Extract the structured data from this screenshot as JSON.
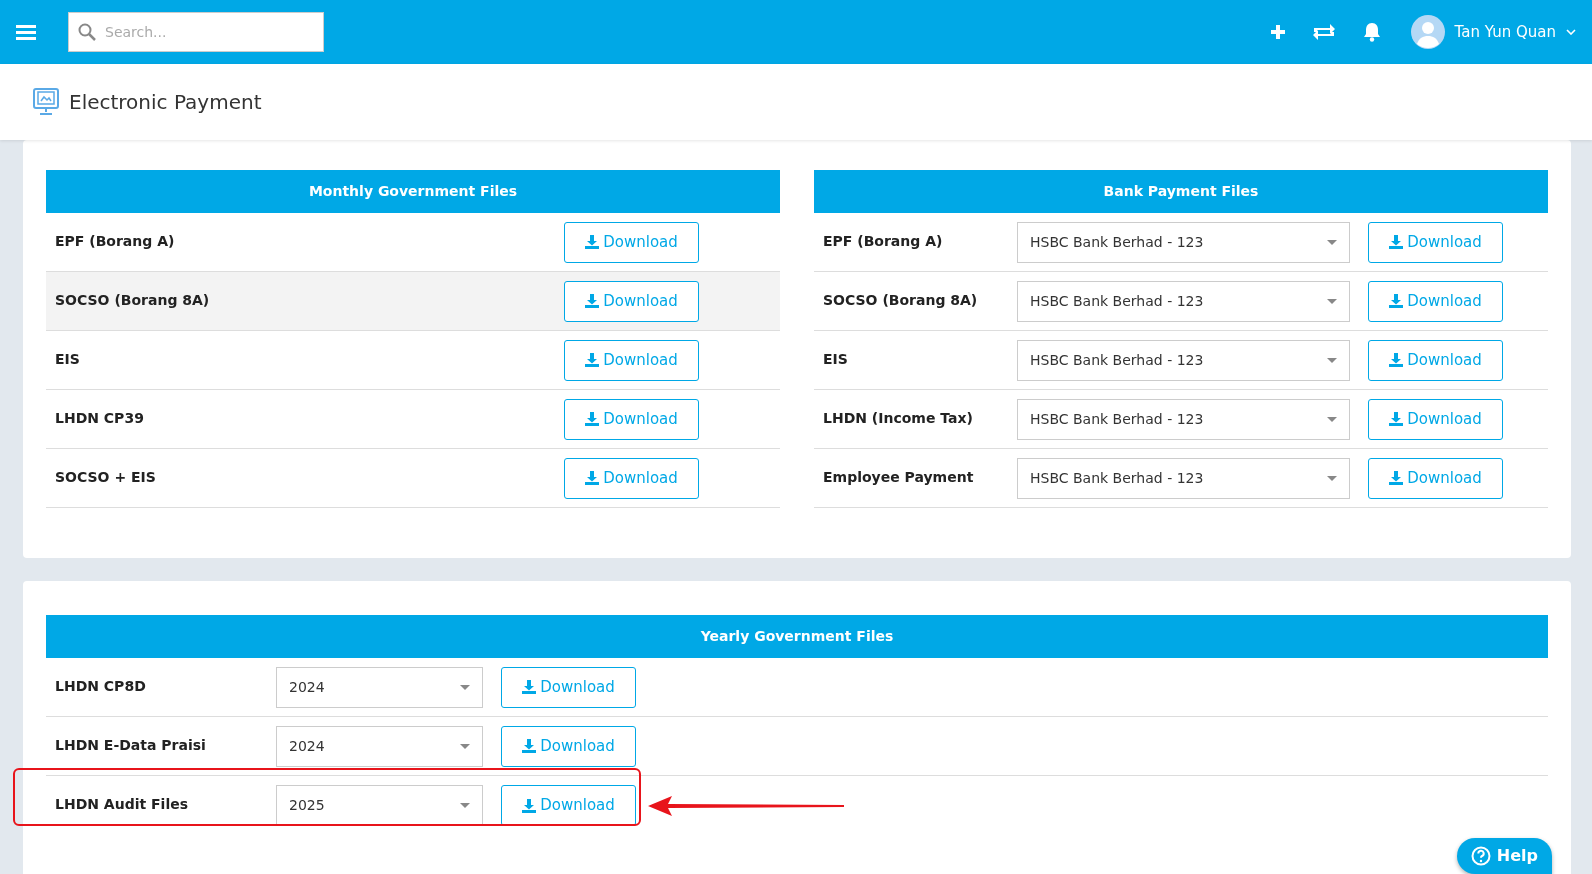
{
  "topbar": {
    "search": {
      "placeholder": "Search..."
    },
    "user": "Tan Yun Quan"
  },
  "page_title": "Electronic Payment",
  "monthly": {
    "title": "Monthly Government Files",
    "rows": [
      {
        "label": "EPF (Borang A)",
        "button": "Download",
        "hover": false
      },
      {
        "label": "SOCSO (Borang 8A)",
        "button": "Download",
        "hover": true
      },
      {
        "label": "EIS",
        "button": "Download",
        "hover": false
      },
      {
        "label": "LHDN CP39",
        "button": "Download",
        "hover": false
      },
      {
        "label": "SOCSO + EIS",
        "button": "Download",
        "hover": false
      }
    ]
  },
  "bank": {
    "title": "Bank Payment Files",
    "rows": [
      {
        "label": "EPF (Borang A)",
        "bank": "HSBC Bank Berhad - 123",
        "button": "Download"
      },
      {
        "label": "SOCSO (Borang 8A)",
        "bank": "HSBC Bank Berhad - 123",
        "button": "Download"
      },
      {
        "label": "EIS",
        "bank": "HSBC Bank Berhad - 123",
        "button": "Download"
      },
      {
        "label": "LHDN (Income Tax)",
        "bank": "HSBC Bank Berhad - 123",
        "button": "Download"
      },
      {
        "label": "Employee Payment",
        "bank": "HSBC Bank Berhad - 123",
        "button": "Download"
      }
    ]
  },
  "yearly": {
    "title": "Yearly Government Files",
    "rows": [
      {
        "label": "LHDN CP8D",
        "year": "2024",
        "button": "Download",
        "annotated": false
      },
      {
        "label": "LHDN E-Data Praisi",
        "year": "2024",
        "button": "Download",
        "annotated": false
      },
      {
        "label": "LHDN Audit Files",
        "year": "2025",
        "button": "Download",
        "annotated": true
      }
    ]
  },
  "help": "Help"
}
